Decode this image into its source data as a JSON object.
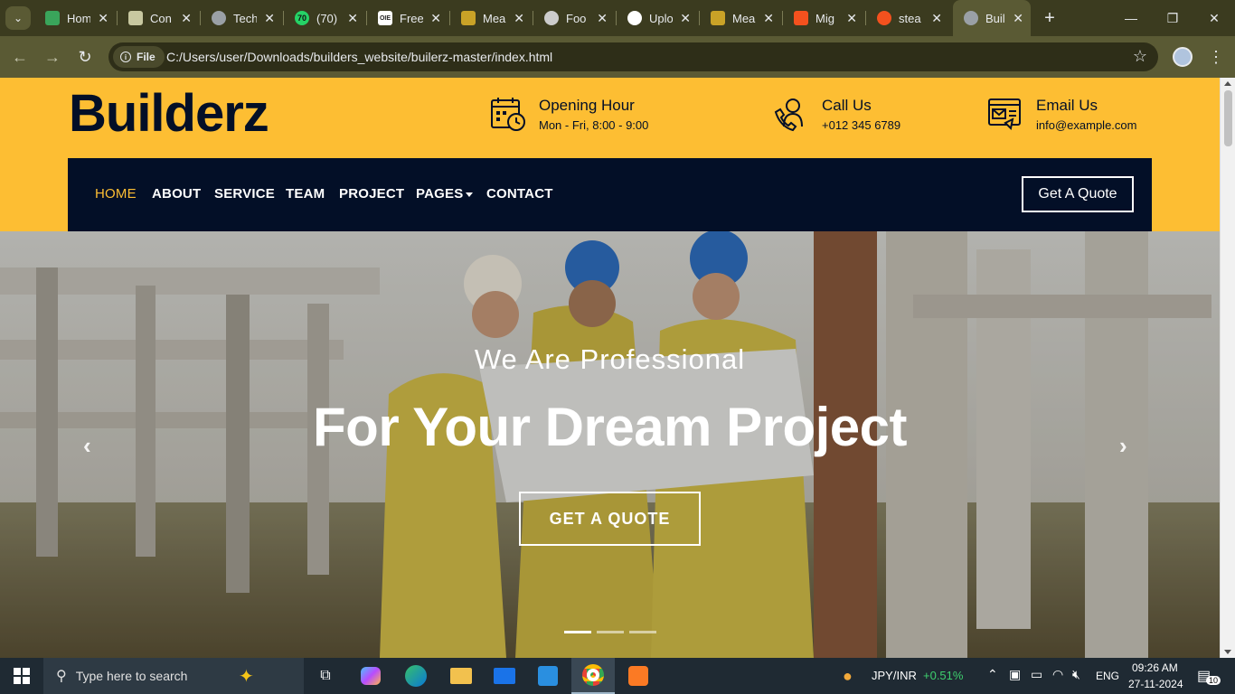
{
  "browser": {
    "tabs": [
      {
        "title": "Hom",
        "favicon_color": "#3aa55b",
        "glyph": ""
      },
      {
        "title": "Con",
        "favicon_color": "#c8c8a0",
        "glyph": ""
      },
      {
        "title": "Tech",
        "favicon_color": "#9aa0a6",
        "glyph": ""
      },
      {
        "title": "(70)",
        "favicon_color": "#25d366",
        "glyph": "70"
      },
      {
        "title": "Free",
        "favicon_color": "#ffffff",
        "glyph": "OIE"
      },
      {
        "title": "Mea",
        "favicon_color": "#c9a227",
        "glyph": ""
      },
      {
        "title": "Foo",
        "favicon_color": "#cccccc",
        "glyph": ""
      },
      {
        "title": "Uplo",
        "favicon_color": "#ffffff",
        "glyph": ""
      },
      {
        "title": "Mea",
        "favicon_color": "#c9a227",
        "glyph": ""
      },
      {
        "title": "Mig",
        "favicon_color": "#f4511e",
        "glyph": ""
      },
      {
        "title": "stea",
        "favicon_color": "#f4511e",
        "glyph": ""
      },
      {
        "title": "Buil",
        "favicon_color": "#9aa0a6",
        "glyph": ""
      }
    ],
    "chip_label": "File",
    "url": "C:/Users/user/Downloads/builders_website/builerz-master/index.html"
  },
  "site": {
    "logo": "Builderz",
    "info": [
      {
        "label": "Opening Hour",
        "value": "Mon - Fri, 8:00 - 9:00"
      },
      {
        "label": "Call Us",
        "value": "+012 345 6789"
      },
      {
        "label": "Email Us",
        "value": "info@example.com"
      }
    ],
    "nav": [
      "HOME",
      "ABOUT",
      "SERVICE",
      "TEAM",
      "PROJECT",
      "PAGES",
      "CONTACT"
    ],
    "nav_quote": "Get A Quote",
    "hero": {
      "subtitle": "We Are Professional",
      "title": "For Your Dream Project",
      "button": "GET A QUOTE",
      "slide_count": 3,
      "active_slide": 1
    },
    "colors": {
      "accent": "#fdbe33",
      "dark": "#030f27"
    }
  },
  "taskbar": {
    "search_placeholder": "Type here to search",
    "ticker_pair": "JPY/INR",
    "ticker_change": "+0.51%",
    "language": "ENG",
    "time": "09:26 AM",
    "date": "27-11-2024",
    "notification_count": "10"
  }
}
